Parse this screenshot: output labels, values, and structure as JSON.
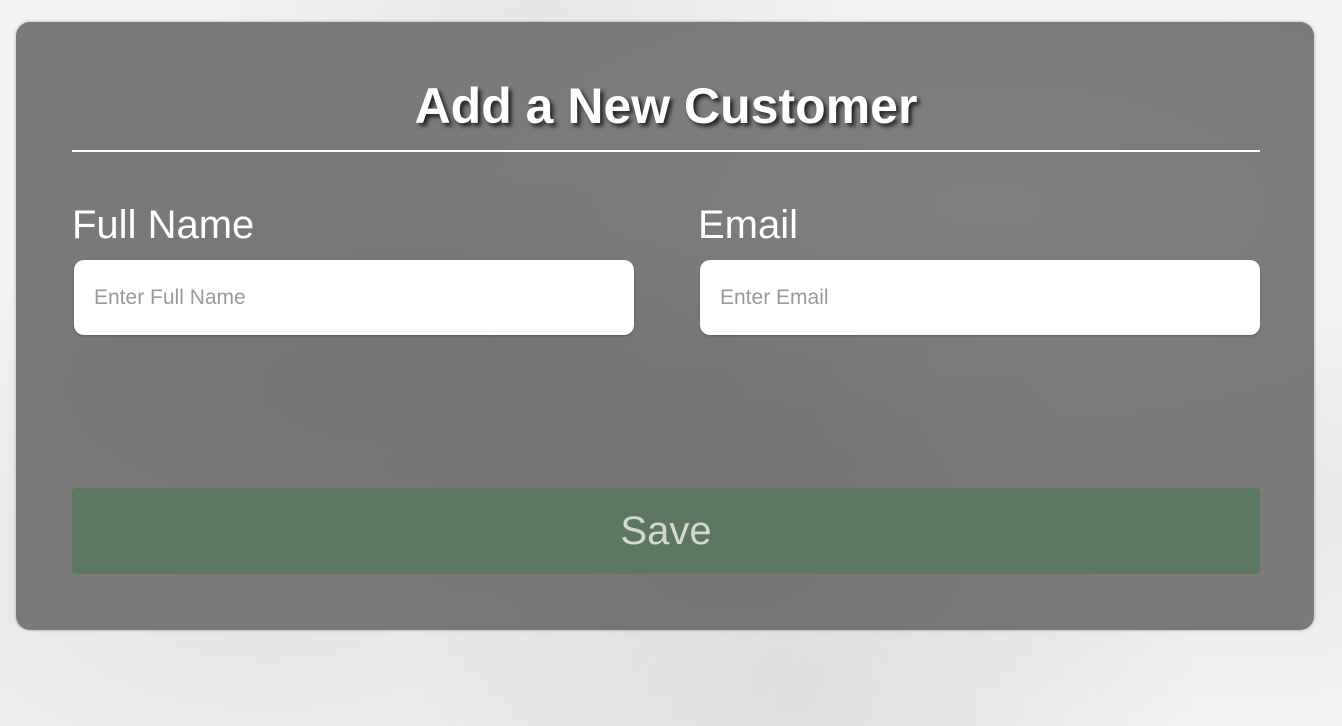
{
  "form": {
    "title": "Add a New Customer",
    "full_name": {
      "label": "Full Name",
      "placeholder": "Enter Full Name",
      "value": ""
    },
    "email": {
      "label": "Email",
      "placeholder": "Enter Email",
      "value": ""
    },
    "save_label": "Save"
  },
  "colors": {
    "card_background": "#7a7a7a",
    "save_button": "#5b775f",
    "page_background": "#f2f2f2"
  }
}
